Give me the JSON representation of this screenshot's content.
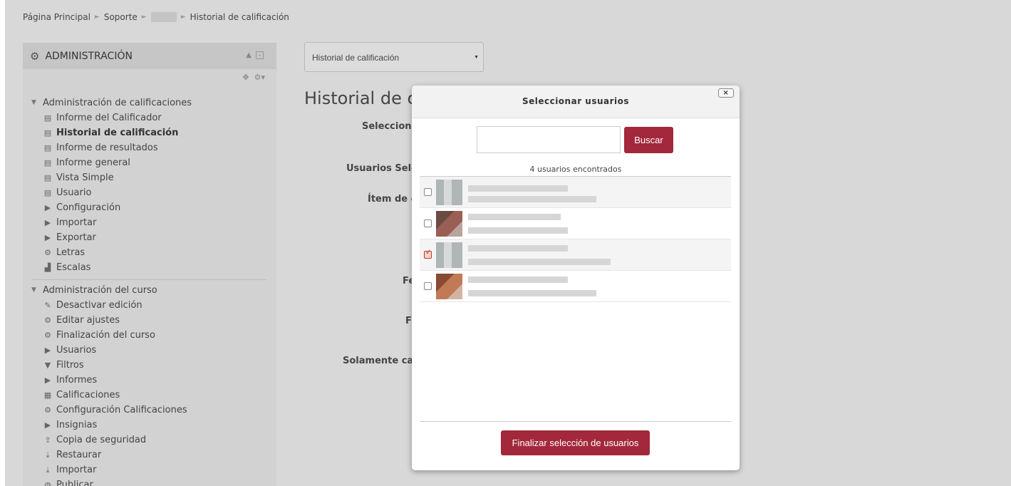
{
  "breadcrumb": {
    "home": "Página Principal",
    "soporte": "Soporte",
    "current": "Historial de calificación"
  },
  "admin": {
    "title": "ADMINISTRACIÓN",
    "grades_section": "Administración de calificaciones",
    "grades_items": [
      {
        "label": "Informe del Calificador",
        "icon": "report-icon"
      },
      {
        "label": "Historial de calificación",
        "icon": "report-icon"
      },
      {
        "label": "Informe de resultados",
        "icon": "report-icon"
      },
      {
        "label": "Informe general",
        "icon": "report-icon"
      },
      {
        "label": "Vista Simple",
        "icon": "report-icon"
      },
      {
        "label": "Usuario",
        "icon": "report-icon"
      },
      {
        "label": "Configuración",
        "icon": "caret-right-icon"
      },
      {
        "label": "Importar",
        "icon": "caret-right-icon"
      },
      {
        "label": "Exportar",
        "icon": "caret-right-icon"
      },
      {
        "label": "Letras",
        "icon": "gear-icon"
      },
      {
        "label": "Escalas",
        "icon": "bar-chart-icon"
      }
    ],
    "course_section": "Administración del curso",
    "course_items": [
      {
        "label": "Desactivar edición",
        "icon": "pencil-icon"
      },
      {
        "label": "Editar ajustes",
        "icon": "gear-icon"
      },
      {
        "label": "Finalización del curso",
        "icon": "gear-icon"
      },
      {
        "label": "Usuarios",
        "icon": "caret-right-icon"
      },
      {
        "label": "Filtros",
        "icon": "filter-icon"
      },
      {
        "label": "Informes",
        "icon": "caret-right-icon"
      },
      {
        "label": "Calificaciones",
        "icon": "table-icon"
      },
      {
        "label": "Configuración Calificaciones",
        "icon": "gear-icon"
      },
      {
        "label": "Insignias",
        "icon": "caret-right-icon"
      },
      {
        "label": "Copia de seguridad",
        "icon": "upload-icon"
      },
      {
        "label": "Restaurar",
        "icon": "download-icon"
      },
      {
        "label": "Importar",
        "icon": "download-icon"
      },
      {
        "label": "Publicar",
        "icon": "globe-icon"
      }
    ]
  },
  "main": {
    "select_value": "Historial de calificación",
    "title": "Historial de c",
    "labels": {
      "select": "Selecciona",
      "users_selected": "Usuarios Sele",
      "item": "Ítem de c",
      "fe": "Fe",
      "f": "F",
      "solamente": "Solamente cal"
    }
  },
  "modal": {
    "title": "Seleccionar usuarios",
    "close": "×",
    "search_button": "Buscar",
    "search_value": "",
    "found": "4 usuarios encontrados",
    "users": [
      {
        "checked": false,
        "avatar_color": "#b9c0c0"
      },
      {
        "checked": false,
        "avatar_color": "#8a5a50"
      },
      {
        "checked": true,
        "avatar_color": "#b9c0c0"
      },
      {
        "checked": false,
        "avatar_color": "#b06a4a"
      }
    ],
    "finish_button": "Finalizar selección de usuarios"
  }
}
